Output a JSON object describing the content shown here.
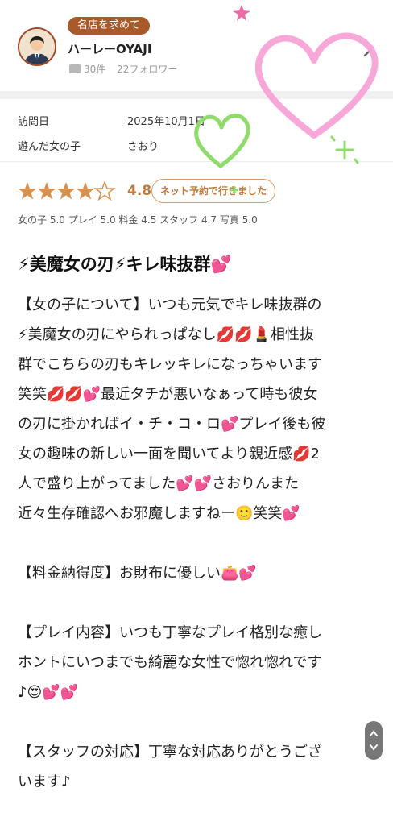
{
  "profile": {
    "tag": "名店を求めて",
    "username": "ハーレーOYAJI",
    "review_count": "30件",
    "followers": "22フォロワー"
  },
  "info": {
    "visit_label": "訪問日",
    "visit_value": "2025年10月1日",
    "girl_label": "遊んだ女の子",
    "girl_value": "さおり"
  },
  "rating": {
    "score": "4.8",
    "stars": 4.5,
    "badge": "ネット予約で行きました",
    "sub_scores": "女の子 5.0 プレイ 5.0 料金 4.5 スタッフ 4.7 写真 5.0"
  },
  "review": {
    "title": "⚡美魔女の刃⚡キレ味抜群💕",
    "lines": [
      "【女の子について】いつも元気でキレ味抜群の",
      "⚡美魔女の刃にやられっぱなし💋💋💄相性抜",
      "群でこちらの刃もキレッキレになっちゃいます",
      "笑笑💋💋💕最近タチが悪いなぁって時も彼女",
      "の刃に掛かればイ・チ・コ・ロ💕プレイ後も彼",
      "女の趣味の新しい一面を聞いてより親近感💋2",
      "人で盛り上がってました💕💕さおりんまた",
      "近々生存確認へお邪魔しますねー🙂笑笑💕",
      "",
      "【料金納得度】お財布に優しい👛💕",
      "",
      "【プレイ内容】いつも丁寧なプレイ格別な癒し",
      "ホントにいつまでも綺麗な女性で惚れ惚れです",
      "♪😍💕💕",
      "",
      "【スタッフの対応】丁寧な対応ありがとうござ",
      "います♪"
    ]
  },
  "colors": {
    "accent": "#c07a3c",
    "tag_bg": "#a85a2a",
    "star": "#d7914f",
    "heart_pink": "#f7a8d8",
    "heart_green": "#8fdc6a"
  }
}
